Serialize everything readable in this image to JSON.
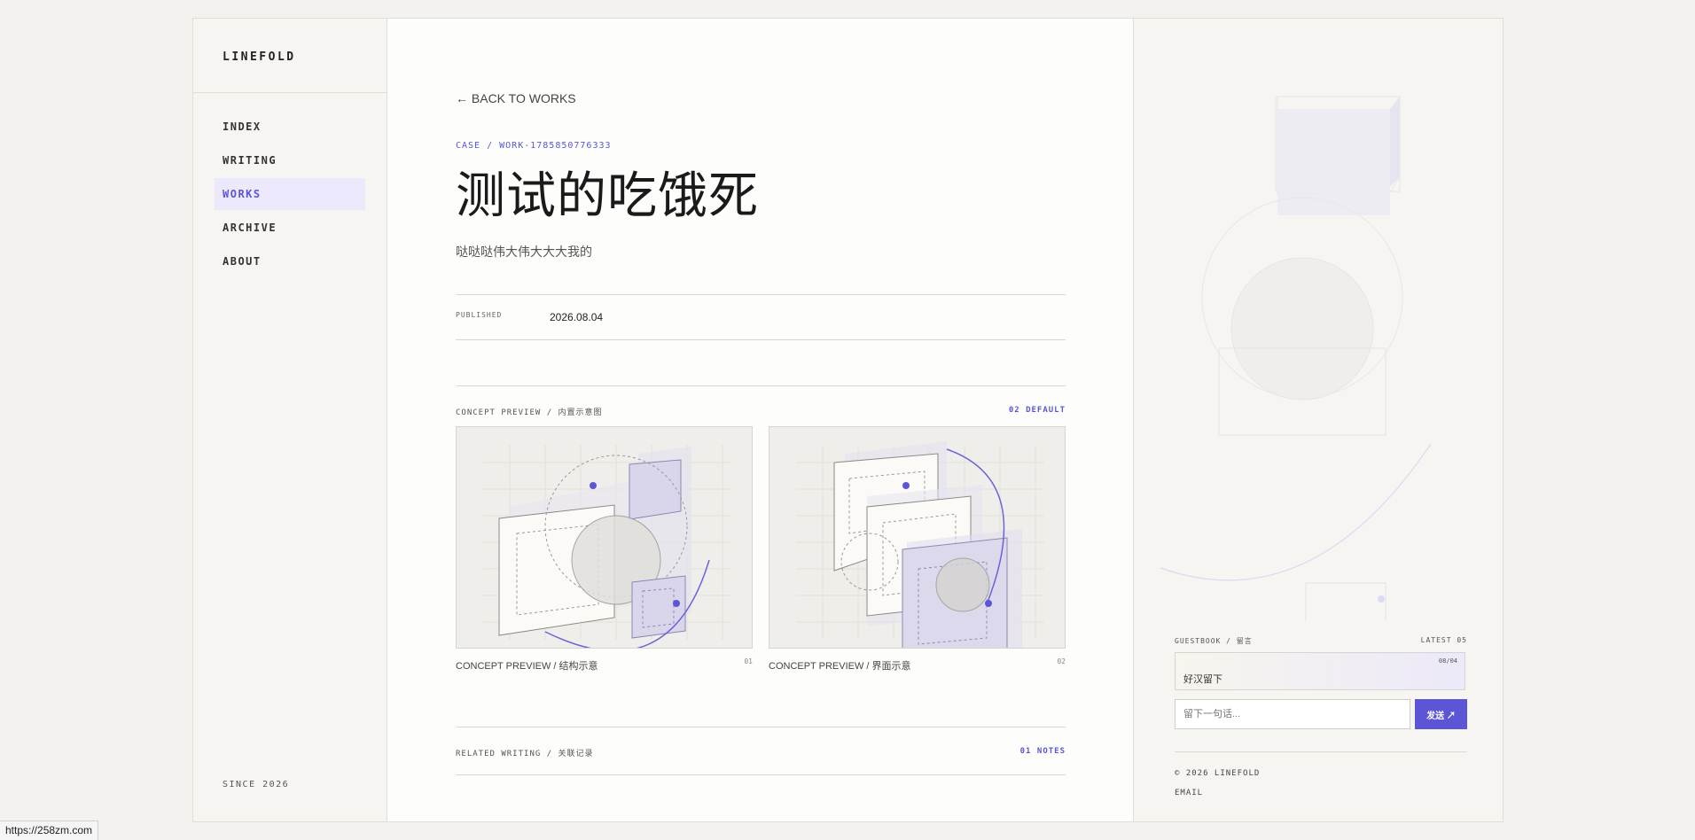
{
  "brand": "LINEFOLD",
  "nav": [
    {
      "label": "INDEX"
    },
    {
      "label": "WRITING"
    },
    {
      "label": "WORKS"
    },
    {
      "label": "ARCHIVE"
    },
    {
      "label": "ABOUT"
    }
  ],
  "since": "SINCE 2026",
  "main": {
    "back": "← BACK TO WORKS",
    "case": "CASE / WORK-1785850776333",
    "title": "测试的吃饿死",
    "subtitle": "哒哒哒伟大伟大大大我的",
    "published_label": "PUBLISHED",
    "published_value": "2026.08.04",
    "concept_left": "CONCEPT PREVIEW / 内置示意图",
    "concept_right": "02 DEFAULT",
    "cards": [
      {
        "caption": "CONCEPT PREVIEW / 结构示意",
        "num": "01"
      },
      {
        "caption": "CONCEPT PREVIEW / 界面示意",
        "num": "02"
      }
    ],
    "related_left": "RELATED WRITING / 关联记录",
    "related_right": "01 NOTES"
  },
  "guestbook": {
    "left": "GUESTBOOK / 留言",
    "right": "LATEST 05",
    "count": "08/04",
    "message": "好汉留下",
    "placeholder": "留下一句话...",
    "send": "发送 ↗"
  },
  "footer": {
    "copyright": "© 2026 LINEFOLD",
    "email": "EMAIL"
  },
  "status_url": "https://258zm.com",
  "colors": {
    "accent": "#5c55d6",
    "accent_light": "#ebe9fb"
  }
}
